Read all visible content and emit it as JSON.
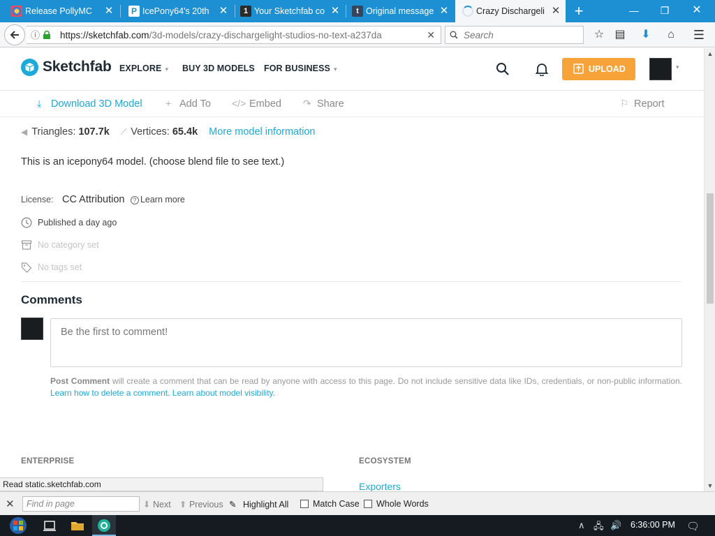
{
  "browser": {
    "tabs": [
      {
        "title": "Release PollyMC",
        "icon": "polymc-icon"
      },
      {
        "title": "IcePony64's 20th",
        "icon": "page-icon"
      },
      {
        "title": "Your Sketchfab co",
        "icon": "number-one-icon"
      },
      {
        "title": "Original message",
        "icon": "tumblr-icon"
      },
      {
        "title": "Crazy Dischargeli",
        "icon": "loading-spinner-icon",
        "active": true
      }
    ],
    "url": {
      "origin": "https://sketchfab.com",
      "path": "/3d-models/crazy-dischargelight-studios-no-text-a237da"
    },
    "search_placeholder": "Search"
  },
  "site": {
    "logo": "Sketchfab",
    "nav": [
      {
        "label": "EXPLORE",
        "dropdown": true
      },
      {
        "label": "BUY 3D MODELS",
        "dropdown": false
      },
      {
        "label": "FOR BUSINESS",
        "dropdown": true
      }
    ],
    "upload_label": "UPLOAD",
    "accent": "#1caad9",
    "upload_color": "#f8a33a"
  },
  "actions": {
    "download": "Download 3D Model",
    "add_to": "Add To",
    "embed": "Embed",
    "share": "Share",
    "report": "Report"
  },
  "stats": {
    "triangles_label": "Triangles:",
    "triangles": "107.7k",
    "vertices_label": "Vertices:",
    "vertices": "65.4k",
    "more_info": "More model information"
  },
  "description": "This is an icepony64 model. (choose blend file to see text.)",
  "license": {
    "label": "License:",
    "name": "CC Attribution",
    "learn_more": "Learn more"
  },
  "meta": {
    "published": "Published a day ago",
    "category": "No category set",
    "tags": "No tags set"
  },
  "comments": {
    "title": "Comments",
    "placeholder": "Be the first to comment!",
    "notice_bold": "Post Comment",
    "notice_text": "will create a comment that can be read by anyone with access to this page. Do not include sensitive data like IDs, credentials, or non-public information.",
    "link_delete": "Learn how to delete a comment.",
    "link_visibility": "Learn about model visibility."
  },
  "footer": {
    "enterprise": "ENTERPRISE",
    "ecosystem": "ECOSYSTEM",
    "ecosystem_link": "Exporters"
  },
  "status_tip": "Read static.sketchfab.com",
  "findbar": {
    "placeholder": "Find in page",
    "next": "Next",
    "previous": "Previous",
    "highlight_all": "Highlight All",
    "match_case": "Match Case",
    "whole_words": "Whole Words"
  },
  "taskbar": {
    "time": "6:36:00 PM"
  }
}
